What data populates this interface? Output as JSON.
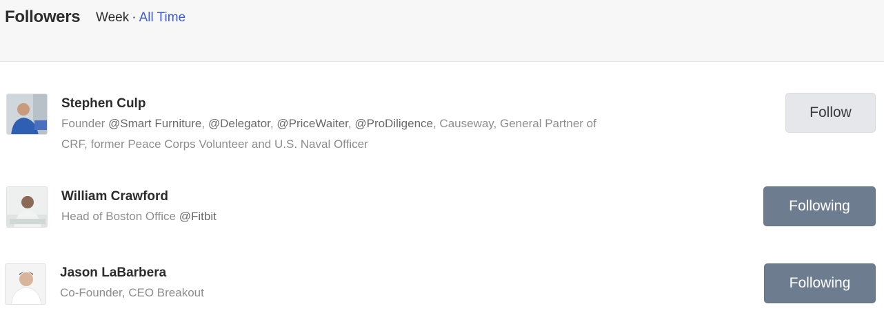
{
  "header": {
    "title": "Followers",
    "filter_week": "Week",
    "filter_sep": "·",
    "filter_all_time": "All Time"
  },
  "followers": [
    {
      "name": "Stephen Culp",
      "bio_parts": [
        "Founder ",
        "@Smart Furniture",
        ", ",
        "@Delegator",
        ", ",
        "@PriceWaiter",
        ", ",
        "@ProDiligence",
        ", Causeway, General Partner of"
      ],
      "bio_line2": "CRF, former Peace Corps Volunteer and U.S. Naval Officer",
      "button": "Follow",
      "following": false
    },
    {
      "name": "William Crawford",
      "bio_parts": [
        "Head of Boston Office ",
        "@Fitbit"
      ],
      "button": "Following",
      "following": true
    },
    {
      "name": "Jason LaBarbera",
      "bio_parts": [
        "Co-Founder, CEO Breakout"
      ],
      "button": "Following",
      "following": true
    }
  ],
  "colors": {
    "link": "#3b5bdb",
    "following_button": "#6e7c90",
    "follow_button": "#e5e7ea"
  }
}
